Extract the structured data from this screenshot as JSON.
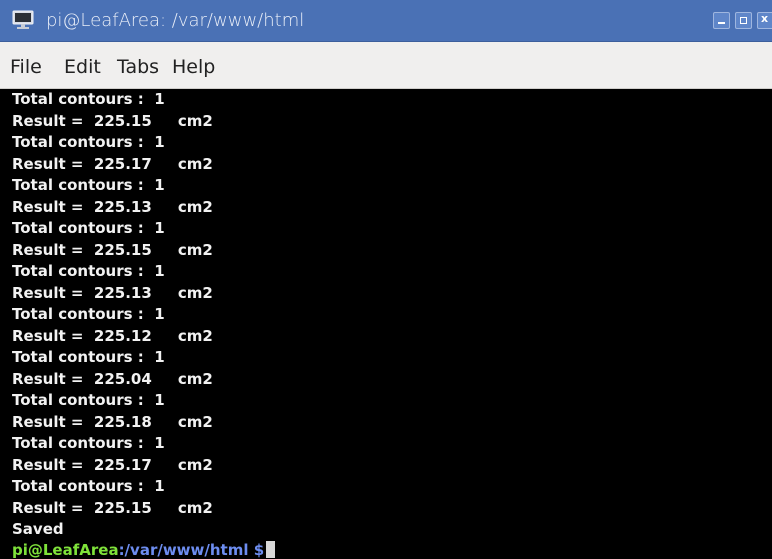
{
  "window": {
    "title": "pi@LeafArea: /var/www/html",
    "icon": "terminal-monitor-icon",
    "controls": [
      "minimize-icon",
      "maximize-icon",
      "close-icon"
    ],
    "close_glyph": "x"
  },
  "menu": {
    "items": [
      "File",
      "Edit",
      "Tabs",
      "Help"
    ]
  },
  "terminal": {
    "lines": [
      "Total contours :  1",
      "Result =  225.15     cm2",
      "Total contours :  1",
      "Result =  225.17     cm2",
      "Total contours :  1",
      "Result =  225.13     cm2",
      "Total contours :  1",
      "Result =  225.15     cm2",
      "Total contours :  1",
      "Result =  225.13     cm2",
      "Total contours :  1",
      "Result =  225.12     cm2",
      "Total contours :  1",
      "Result =  225.04     cm2",
      "Total contours :  1",
      "Result =  225.18     cm2",
      "Total contours :  1",
      "Result =  225.17     cm2",
      "Total contours :  1",
      "Result =  225.15     cm2",
      "Saved"
    ],
    "prompt": {
      "user_host": "pi@LeafArea",
      "path": ":/var/www/html",
      "sign": " $"
    }
  },
  "colors": {
    "titlebar": "#4a71b5",
    "menubar": "#f0efee",
    "terminal_bg": "#000000",
    "terminal_fg": "#f2f2f2",
    "prompt_user": "#7fe23a",
    "prompt_path": "#6d8df0"
  }
}
